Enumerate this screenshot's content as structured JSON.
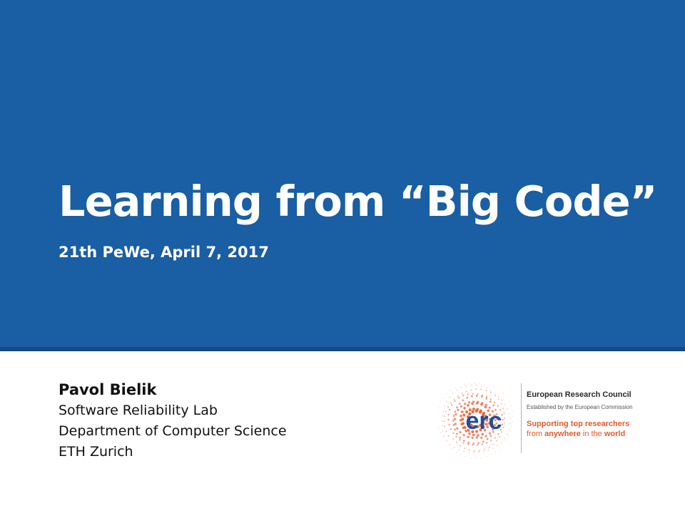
{
  "slide": {
    "title": "Learning from “Big Code”",
    "subtitle": "21th PeWe, April 7, 2017"
  },
  "author": {
    "name": "Pavol Bielik",
    "affiliation": [
      "Software Reliability Lab",
      "Department of Computer Science",
      "ETH Zurich"
    ]
  },
  "logo": {
    "mark": "erc",
    "name": "European Research Council",
    "established": "Established by the European Commission",
    "tagline_line1": "Supporting top researchers",
    "tagline_line2_pre": "from ",
    "tagline_line2_bold1": "anywhere",
    "tagline_line2_mid": " in the ",
    "tagline_line2_bold2": "world",
    "icon": "erc-dot-burst-icon"
  },
  "colors": {
    "banner": "#1a5ea4",
    "banner_rule": "#154a83",
    "erc_orange": "#e8592a",
    "erc_text_blue": "#1f4e9c"
  }
}
